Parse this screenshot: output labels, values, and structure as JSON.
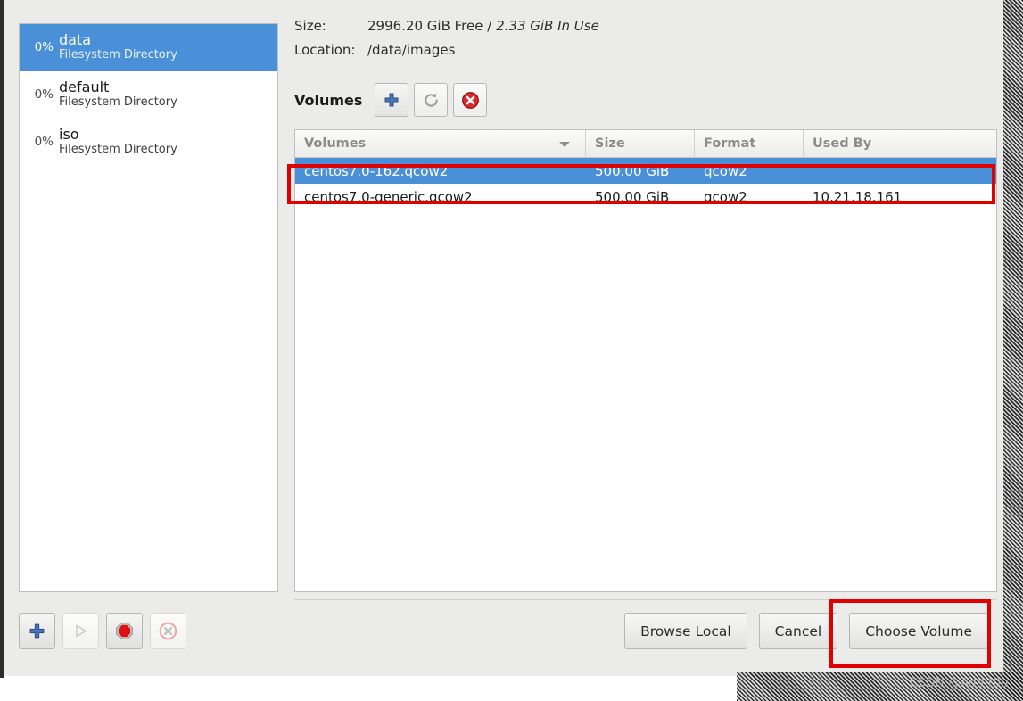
{
  "dialog": {
    "pools": [
      {
        "percent": "0%",
        "name": "data",
        "type": "Filesystem Directory",
        "selected": true
      },
      {
        "percent": "0%",
        "name": "default",
        "type": "Filesystem Directory",
        "selected": false
      },
      {
        "percent": "0%",
        "name": "iso",
        "type": "Filesystem Directory",
        "selected": false
      }
    ],
    "info": {
      "size_label": "Size:",
      "size_free": "2996.20 GiB Free /",
      "size_inuse": "2.33 GiB In Use",
      "location_label": "Location:",
      "location_value": "/data/images"
    },
    "volumes_section": {
      "title": "Volumes",
      "buttons": [
        {
          "name": "add-volume-button",
          "icon": "plus-icon"
        },
        {
          "name": "refresh-volumes-button",
          "icon": "refresh-icon"
        },
        {
          "name": "delete-volume-button",
          "icon": "delete-icon"
        }
      ]
    },
    "table": {
      "columns": [
        "Volumes",
        "Size",
        "Format",
        "Used By"
      ],
      "rows": [
        {
          "name": "centos7.0-162.qcow2",
          "size": "500.00 GiB",
          "format": "qcow2",
          "used_by": "",
          "selected": true
        },
        {
          "name": "centos7.0-generic.qcow2",
          "size": "500.00 GiB",
          "format": "qcow2",
          "used_by": "10.21.18.161",
          "selected": false
        }
      ]
    },
    "pool_actions": [
      {
        "name": "add-pool-button",
        "icon": "plus-icon",
        "enabled": true
      },
      {
        "name": "start-pool-button",
        "icon": "play-icon",
        "enabled": false
      },
      {
        "name": "stop-pool-button",
        "icon": "stop-icon",
        "enabled": true
      },
      {
        "name": "delete-pool-button",
        "icon": "delete-icon",
        "enabled": false
      }
    ],
    "footer_buttons": [
      {
        "name": "browse-local-button",
        "label": "Browse Local"
      },
      {
        "name": "cancel-button",
        "label": "Cancel"
      },
      {
        "name": "choose-volume-button",
        "label": "Choose Volume"
      }
    ],
    "watermark": "CSDN @Addit0u",
    "colors": {
      "selection_blue": "#4a90d9",
      "annotation_red": "#e00000",
      "window_bg": "#ebebe9"
    }
  }
}
